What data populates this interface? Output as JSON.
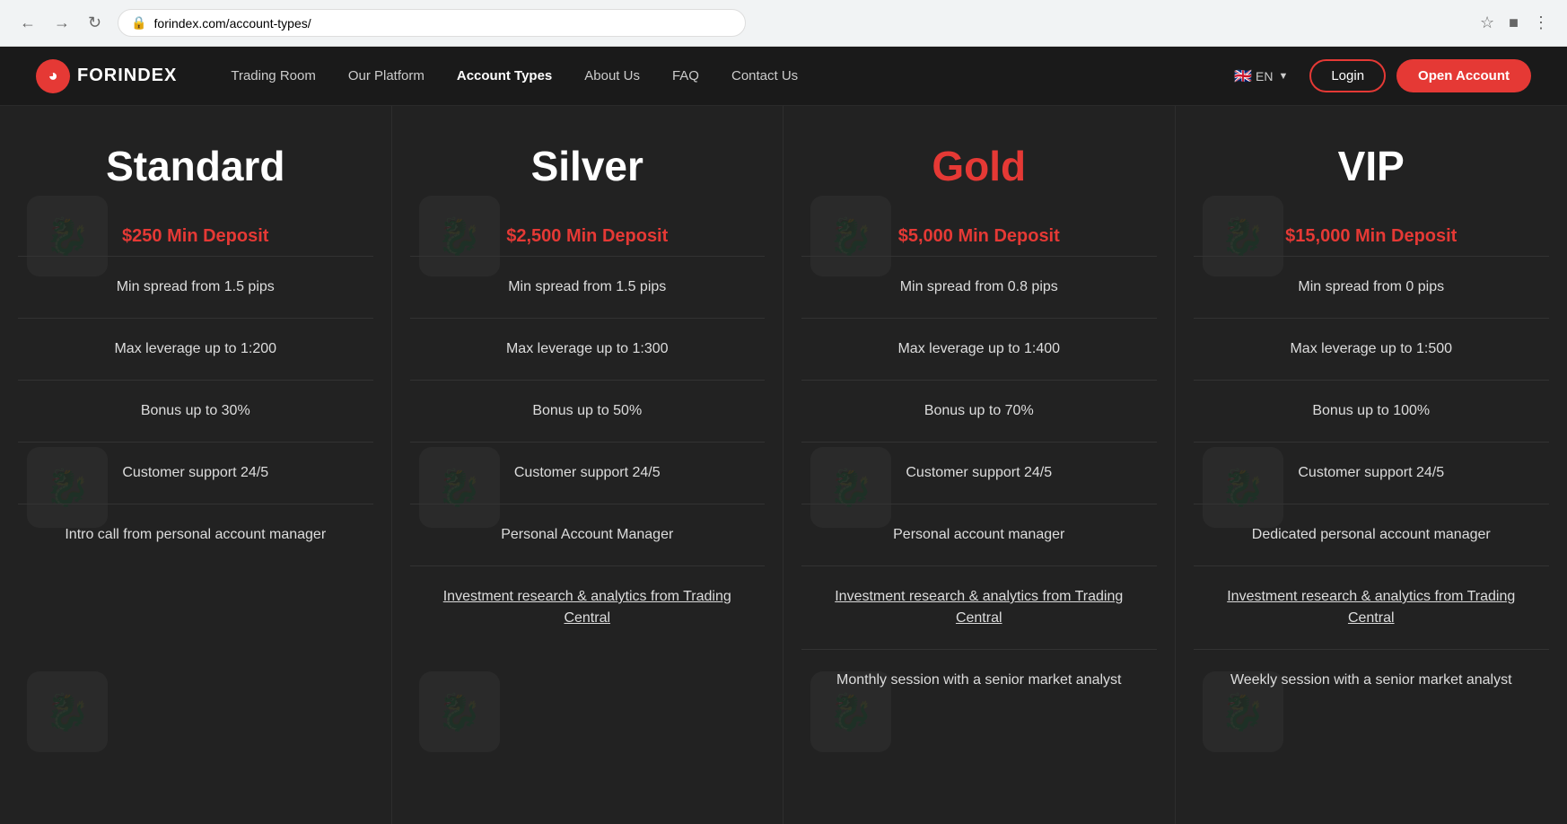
{
  "browser": {
    "url": "forindex.com/account-types/",
    "back_title": "Back",
    "forward_title": "Forward",
    "refresh_title": "Refresh"
  },
  "navbar": {
    "logo_text": "FORINDEX",
    "links": [
      {
        "label": "Trading Room",
        "active": false
      },
      {
        "label": "Our Platform",
        "active": false
      },
      {
        "label": "Account Types",
        "active": true
      },
      {
        "label": "About Us",
        "active": false
      },
      {
        "label": "FAQ",
        "active": false
      },
      {
        "label": "Contact Us",
        "active": false
      }
    ],
    "language": "EN",
    "login_label": "Login",
    "open_account_label": "Open Account"
  },
  "accounts": [
    {
      "id": "standard",
      "title": "Standard",
      "title_class": "",
      "deposit": "$250 Min Deposit",
      "features": [
        {
          "text": "Min spread from 1.5 pips",
          "link": false
        },
        {
          "text": "Max leverage up to 1:200",
          "link": false
        },
        {
          "text": "Bonus up to 30%",
          "link": false
        },
        {
          "text": "Customer support 24/5",
          "link": false
        },
        {
          "text": "Intro call from personal account manager",
          "link": false
        }
      ]
    },
    {
      "id": "silver",
      "title": "Silver",
      "title_class": "",
      "deposit": "$2,500 Min Deposit",
      "features": [
        {
          "text": "Min spread from 1.5 pips",
          "link": false
        },
        {
          "text": "Max leverage up to 1:300",
          "link": false
        },
        {
          "text": "Bonus up to 50%",
          "link": false
        },
        {
          "text": "Customer support 24/5",
          "link": false
        },
        {
          "text": "Personal Account Manager",
          "link": false
        },
        {
          "text": "Investment research & analytics from Trading Central",
          "link": true
        }
      ]
    },
    {
      "id": "gold",
      "title": "Gold",
      "title_class": "gold-text",
      "deposit": "$5,000 Min Deposit",
      "features": [
        {
          "text": "Min spread from 0.8 pips",
          "link": false
        },
        {
          "text": "Max leverage up to 1:400",
          "link": false
        },
        {
          "text": "Bonus up to 70%",
          "link": false
        },
        {
          "text": "Customer support 24/5",
          "link": false
        },
        {
          "text": "Personal account manager",
          "link": false
        },
        {
          "text": "Investment research & analytics from Trading Central",
          "link": true
        },
        {
          "text": "Monthly session with a senior market analyst",
          "link": false
        }
      ]
    },
    {
      "id": "vip",
      "title": "VIP",
      "title_class": "",
      "deposit": "$15,000 Min Deposit",
      "features": [
        {
          "text": "Min spread from 0 pips",
          "link": false
        },
        {
          "text": "Max leverage up to 1:500",
          "link": false
        },
        {
          "text": "Bonus up to 100%",
          "link": false
        },
        {
          "text": "Customer support 24/5",
          "link": false
        },
        {
          "text": "Dedicated personal account manager",
          "link": false
        },
        {
          "text": "Investment research & analytics from Trading Central",
          "link": true
        },
        {
          "text": "Weekly session with a senior market analyst",
          "link": false
        }
      ]
    }
  ]
}
